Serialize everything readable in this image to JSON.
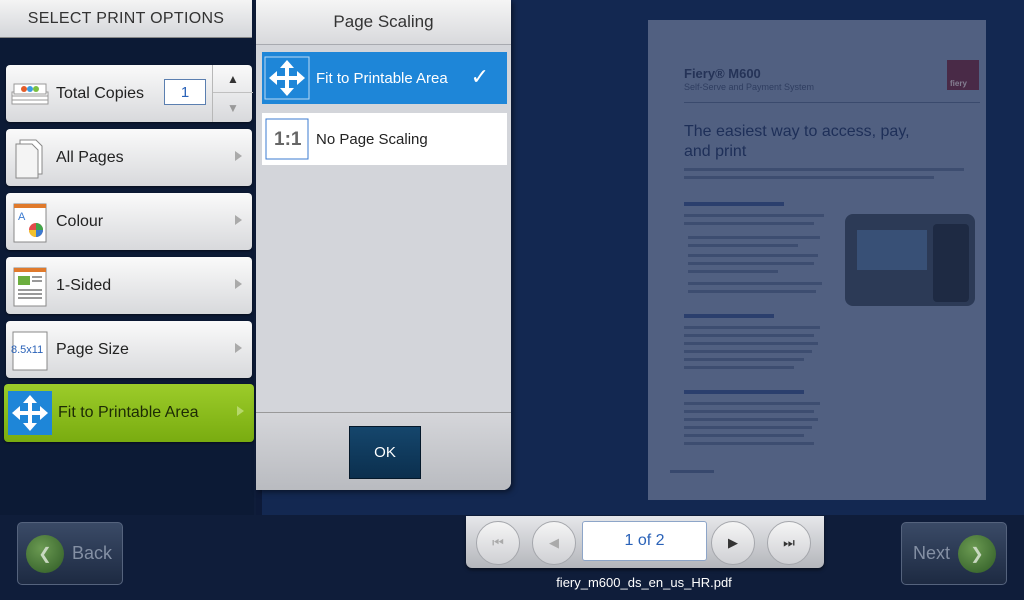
{
  "sidebar": {
    "header": "SELECT PRINT OPTIONS",
    "total_copies": {
      "label": "Total Copies",
      "value": "1",
      "up_icon": "▲",
      "down_icon": "▼"
    },
    "options": [
      {
        "label": "All Pages",
        "icon": "page-range-icon"
      },
      {
        "label": "Colour",
        "icon": "colour-icon"
      },
      {
        "label": "1-Sided",
        "icon": "duplex-icon"
      },
      {
        "label": "Page Size",
        "icon": "page-size-icon",
        "icon_text": "8.5x11"
      },
      {
        "label": "Fit to Printable Area",
        "icon": "scaling-icon",
        "selected": true
      }
    ]
  },
  "dialog": {
    "title": "Page Scaling",
    "items": [
      {
        "label": "Fit to Printable Area",
        "selected": true,
        "icon": "fit-arrows-icon"
      },
      {
        "label": "No Page Scaling",
        "selected": false,
        "icon": "one-to-one-icon",
        "icon_text": "1:1"
      }
    ],
    "check": "✓",
    "ok": "OK"
  },
  "preview": {
    "brand": "Fiery® M600",
    "subtitle": "Self-Serve and Payment System",
    "logo_text": "fiery",
    "heading": "The easiest way to access, pay, and print"
  },
  "pager": {
    "page_indicator": "1 of 2",
    "first_icon": "⏮",
    "prev_icon": "◀",
    "next_icon": "▶",
    "last_icon": "⏭"
  },
  "filename": "fiery_m600_ds_en_us_HR.pdf",
  "nav": {
    "back": "Back",
    "next": "Next",
    "back_icon": "❮",
    "next_icon": "❯"
  },
  "colors": {
    "selected_green": "#8bbf1f",
    "selected_blue": "#1e86d8",
    "background": "#0f1d3a"
  }
}
